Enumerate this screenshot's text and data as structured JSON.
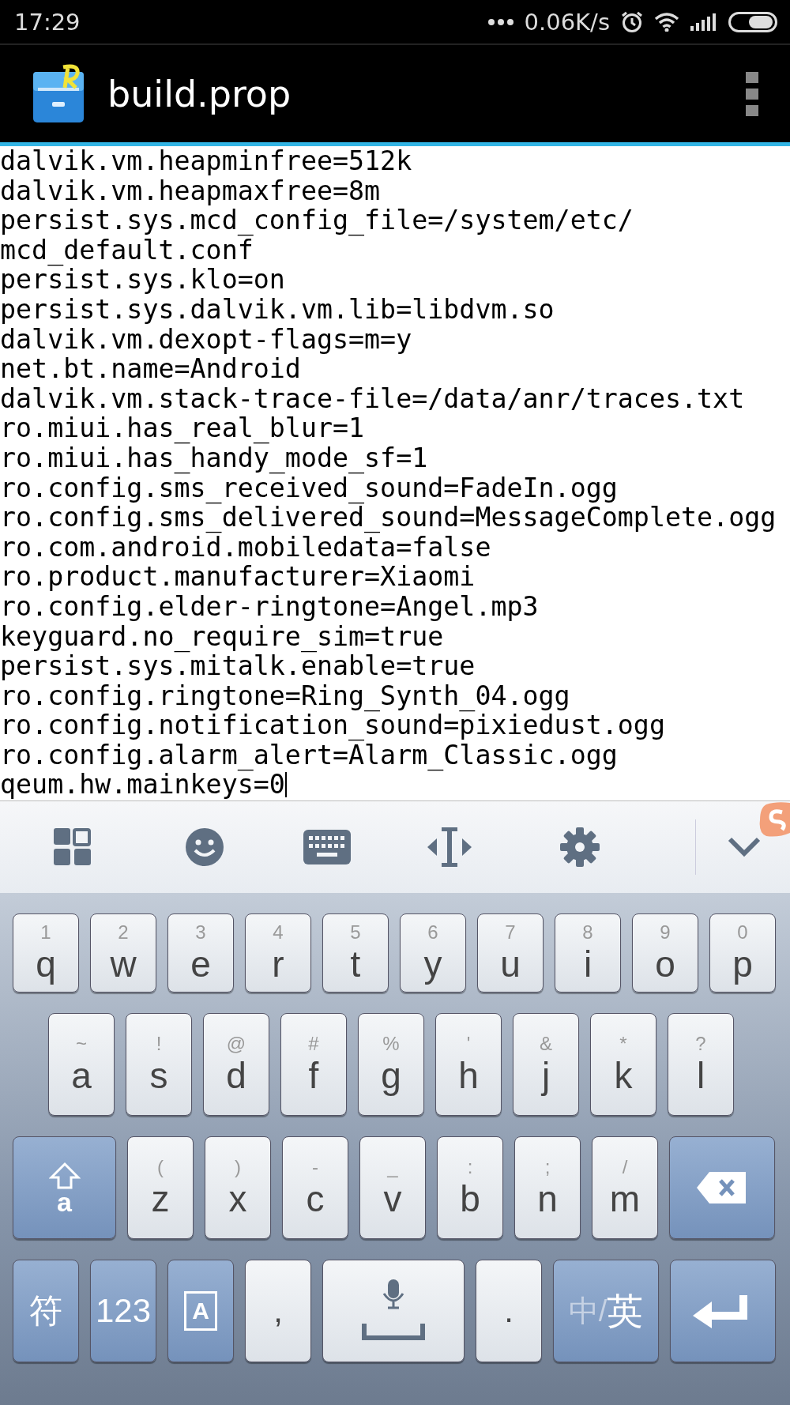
{
  "status_bar": {
    "time": "17:29",
    "speed": "0.06K/s"
  },
  "title_bar": {
    "title": "build.prop"
  },
  "editor": {
    "caret_at_end": true,
    "lines": [
      "dalvik.vm.heapminfree=512k",
      "dalvik.vm.heapmaxfree=8m",
      "persist.sys.mcd_config_file=/system/etc/",
      "mcd_default.conf",
      "persist.sys.klo=on",
      "persist.sys.dalvik.vm.lib=libdvm.so",
      "dalvik.vm.dexopt-flags=m=y",
      "net.bt.name=Android",
      "dalvik.vm.stack-trace-file=/data/anr/traces.txt",
      "ro.miui.has_real_blur=1",
      "ro.miui.has_handy_mode_sf=1",
      "ro.config.sms_received_sound=FadeIn.ogg",
      "ro.config.sms_delivered_sound=MessageComplete.ogg",
      "ro.com.android.mobiledata=false",
      "ro.product.manufacturer=Xiaomi",
      "ro.config.elder-ringtone=Angel.mp3",
      "keyguard.no_require_sim=true",
      "persist.sys.mitalk.enable=true",
      "ro.config.ringtone=Ring_Synth_04.ogg",
      "ro.config.notification_sound=pixiedust.ogg",
      "ro.config.alarm_alert=Alarm_Classic.ogg",
      "qeum.hw.mainkeys=0"
    ]
  },
  "keyboard": {
    "row_1": [
      {
        "kind": "letter",
        "label": "q",
        "hint": "1"
      },
      {
        "kind": "letter",
        "label": "w",
        "hint": "2"
      },
      {
        "kind": "letter",
        "label": "e",
        "hint": "3"
      },
      {
        "kind": "letter",
        "label": "r",
        "hint": "4"
      },
      {
        "kind": "letter",
        "label": "t",
        "hint": "5"
      },
      {
        "kind": "letter",
        "label": "y",
        "hint": "6"
      },
      {
        "kind": "letter",
        "label": "u",
        "hint": "7"
      },
      {
        "kind": "letter",
        "label": "i",
        "hint": "8"
      },
      {
        "kind": "letter",
        "label": "o",
        "hint": "9"
      },
      {
        "kind": "letter",
        "label": "p",
        "hint": "0"
      }
    ],
    "row_2": [
      {
        "kind": "letter",
        "label": "a",
        "hint": "~"
      },
      {
        "kind": "letter",
        "label": "s",
        "hint": "!"
      },
      {
        "kind": "letter",
        "label": "d",
        "hint": "@"
      },
      {
        "kind": "letter",
        "label": "f",
        "hint": "#"
      },
      {
        "kind": "letter",
        "label": "g",
        "hint": "%"
      },
      {
        "kind": "letter",
        "label": "h",
        "hint": "'"
      },
      {
        "kind": "letter",
        "label": "j",
        "hint": "&"
      },
      {
        "kind": "letter",
        "label": "k",
        "hint": "*"
      },
      {
        "kind": "letter",
        "label": "l",
        "hint": "?"
      }
    ],
    "row_3": [
      {
        "kind": "shift",
        "label": "a"
      },
      {
        "kind": "letter",
        "label": "z",
        "hint": "("
      },
      {
        "kind": "letter",
        "label": "x",
        "hint": ")"
      },
      {
        "kind": "letter",
        "label": "c",
        "hint": "-"
      },
      {
        "kind": "letter",
        "label": "v",
        "hint": "_"
      },
      {
        "kind": "letter",
        "label": "b",
        "hint": ":"
      },
      {
        "kind": "letter",
        "label": "n",
        "hint": ";"
      },
      {
        "kind": "letter",
        "label": "m",
        "hint": "/"
      },
      {
        "kind": "backspace"
      }
    ],
    "row_4": [
      {
        "kind": "function",
        "label": "符"
      },
      {
        "kind": "function",
        "label": "123"
      },
      {
        "kind": "layout",
        "label": "A"
      },
      {
        "kind": "punct",
        "label": ","
      },
      {
        "kind": "space"
      },
      {
        "kind": "punct",
        "label": "."
      },
      {
        "kind": "lang",
        "separator": "/",
        "options": [
          {
            "label": "中",
            "selected": false
          },
          {
            "label": "英",
            "selected": true
          }
        ]
      },
      {
        "kind": "enter"
      }
    ]
  }
}
